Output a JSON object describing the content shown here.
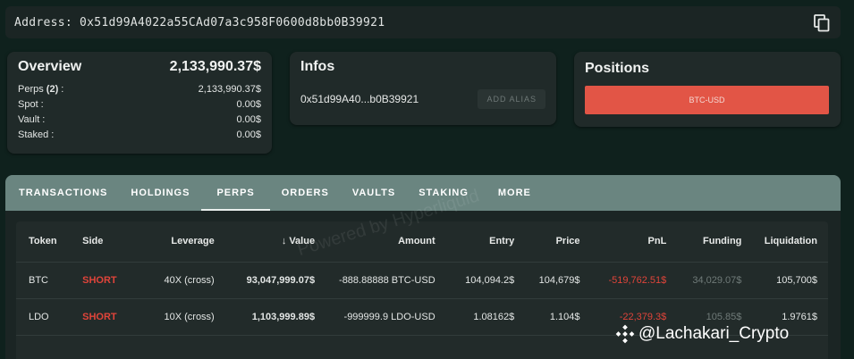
{
  "address_bar": {
    "label": "Address:",
    "value": "0x51d99A4022a55CAd07a3c958F0600d8bb0B39921"
  },
  "overview": {
    "title": "Overview",
    "total": "2,133,990.37$",
    "rows": [
      {
        "label_pre": "Perps ",
        "label_bold": "(2)",
        "label_post": " :",
        "value": "2,133,990.37$"
      },
      {
        "label_pre": "Spot :",
        "label_bold": "",
        "label_post": "",
        "value": "0.00$"
      },
      {
        "label_pre": "Vault :",
        "label_bold": "",
        "label_post": "",
        "value": "0.00$"
      },
      {
        "label_pre": "Staked :",
        "label_bold": "",
        "label_post": "",
        "value": "0.00$"
      }
    ]
  },
  "infos": {
    "title": "Infos",
    "short_address": "0x51d99A40...b0B39921",
    "alias_button": "ADD ALIAS"
  },
  "positions": {
    "title": "Positions",
    "button_label": "BTC-USD",
    "button_color": "#e25546"
  },
  "tabs": [
    "TRANSACTIONS",
    "HOLDINGS",
    "PERPS",
    "ORDERS",
    "VAULTS",
    "STAKING",
    "MORE"
  ],
  "active_tab": "PERPS",
  "table": {
    "headers": {
      "token": "Token",
      "side": "Side",
      "leverage": "Leverage",
      "value_arrow": "↓",
      "value": "Value",
      "amount": "Amount",
      "entry": "Entry",
      "price": "Price",
      "pnl": "PnL",
      "funding": "Funding",
      "liquidation": "Liquidation"
    },
    "rows": [
      {
        "token": "BTC",
        "side": "SHORT",
        "leverage": "40X (cross)",
        "value": "93,047,999.07$",
        "amount": "-888.88888 BTC-USD",
        "entry": "104,094.2$",
        "price": "104,679$",
        "pnl": "-519,762.51$",
        "funding": "34,029.07$",
        "liquidation": "105,700$"
      },
      {
        "token": "LDO",
        "side": "SHORT",
        "leverage": "10X (cross)",
        "value": "1,103,999.89$",
        "amount": "-999999.9 LDO-USD",
        "entry": "1.08162$",
        "price": "1.104$",
        "pnl": "-22,379.3$",
        "funding": "105.85$",
        "liquidation": "1.9761$"
      }
    ]
  },
  "watermark": "Powered by Hyperliquid",
  "credit": "@Lachakari_Crypto",
  "colors": {
    "background": "#0f211d",
    "card": "#202a29",
    "tabbar": "#6a8580",
    "negative": "#e0443a"
  }
}
